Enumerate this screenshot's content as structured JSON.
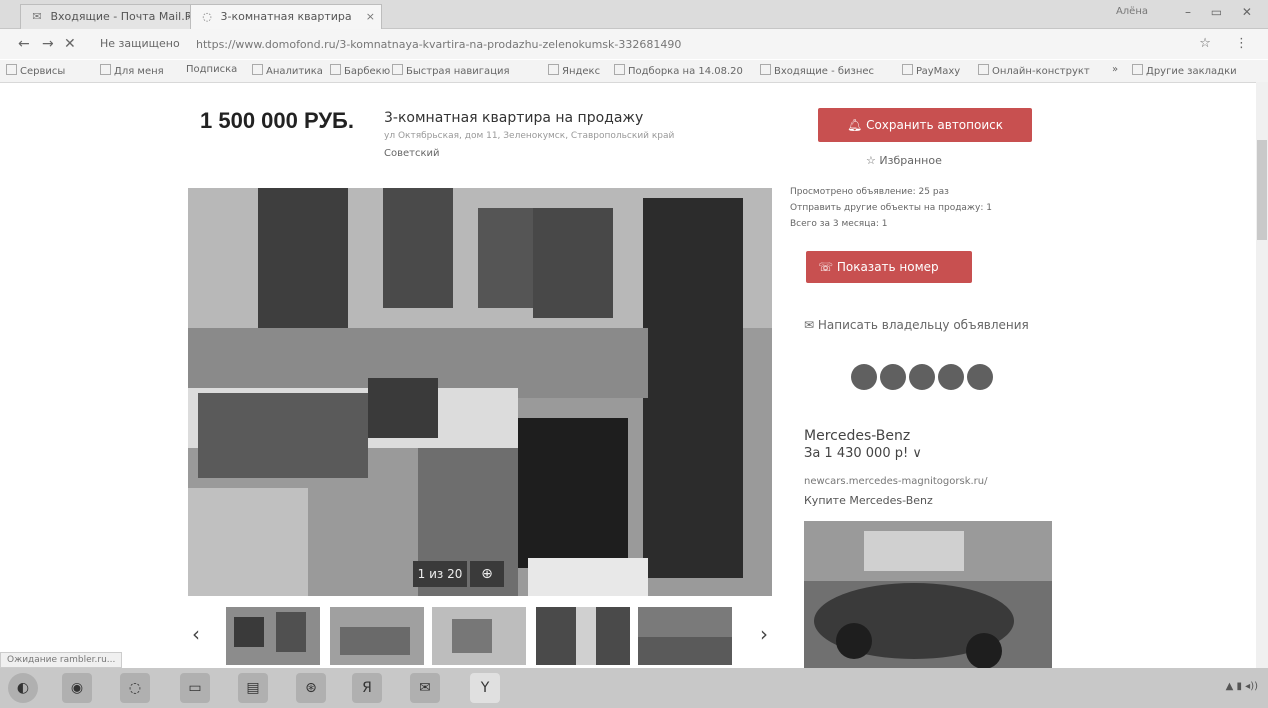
{
  "browser": {
    "tabs": [
      {
        "label": "Входящие - Почта Mail.Ru"
      },
      {
        "label": "3-комнатная квартира"
      }
    ],
    "window_label": "Алёна"
  },
  "addressbar": {
    "back": "←",
    "forward": "→",
    "reload": "✕",
    "security": "Не защищено",
    "url": "https://www.domofond.ru/3-komnatnaya-kvartira-na-prodazhu-zelenokumsk-332681490"
  },
  "bookmarks": [
    {
      "label": "Сервисы"
    },
    {
      "label": "Для меня"
    },
    {
      "label": "Подписка"
    },
    {
      "label": "Аналитика"
    },
    {
      "label": "Барбекю"
    },
    {
      "label": "Быстрая навигация"
    },
    {
      "label": "Яндекс"
    },
    {
      "label": "Подборка на 14.08.20"
    },
    {
      "label": "Входящие - бизнес"
    },
    {
      "label": "PayMaxy"
    },
    {
      "label": "Онлайн-конструкт"
    },
    {
      "label": "»"
    },
    {
      "label": "Другие закладки"
    }
  ],
  "listing": {
    "price": "1 500 000 РУБ.",
    "title": "3-комнатная квартира на продажу",
    "address": "ул Октябрьская, дом 11, Зеленокумск, Ставропольский край",
    "district": "Советский",
    "save_search": "Сохранить автопоиск",
    "favorite": "Избранное",
    "stats": [
      "Просмотрено объявление: 25 раз",
      "Отправить другие объекты на продажу: 1",
      "Всего за 3 месяца: 1"
    ],
    "show_phone": "Показать номер",
    "write_owner": "Написать владельцу объявления",
    "photo_counter": "1 из 20",
    "prev": "‹",
    "next": "›"
  },
  "ad": {
    "title": "Mercedes-Benz",
    "price": "За 1 430 000 р! ∨",
    "domain": "newcars.mercedes-magnitogorsk.ru/",
    "cta": "Купите Mercedes-Benz"
  },
  "status_bar": "Ожидание rambler.ru...",
  "taskbar": {
    "items": [
      "◐",
      "◉",
      "◌",
      "▭",
      "▤",
      "⊛",
      "Я",
      "✉",
      "Y"
    ]
  }
}
